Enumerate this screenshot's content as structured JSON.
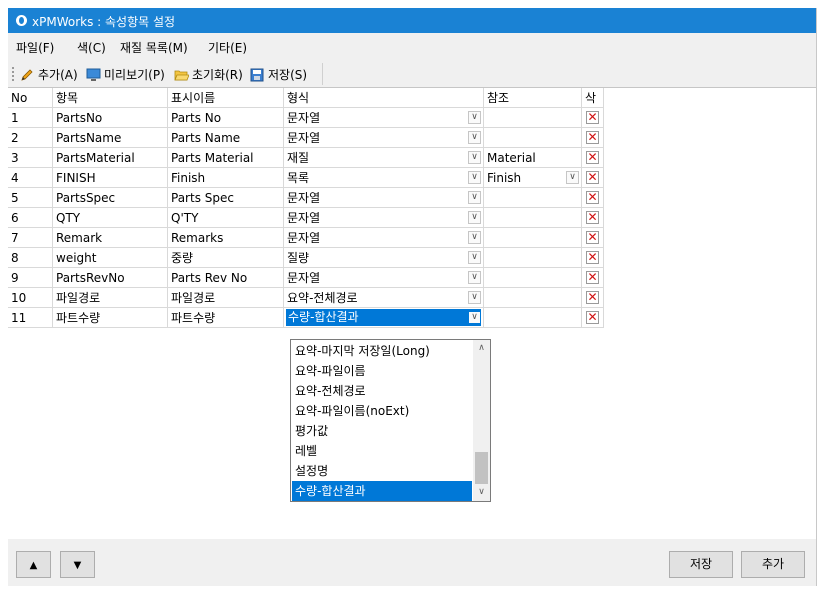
{
  "window": {
    "title": "xPMWorks : 속성항목 설정"
  },
  "menu": [
    {
      "label": "파일(F)"
    },
    {
      "label": "색(C)"
    },
    {
      "label": "재질 목록(M)"
    },
    {
      "label": "기타(E)"
    }
  ],
  "toolbar": {
    "add": "추가(A)",
    "preview": "미리보기(P)",
    "reset": "초기화(R)",
    "save": "저장(S)"
  },
  "columns": [
    "No",
    "항목",
    "표시이름",
    "형식",
    "참조",
    "삭"
  ],
  "rows": [
    {
      "no": "1",
      "item": "PartsNo",
      "display": "Parts No",
      "format": "문자열",
      "ref": ""
    },
    {
      "no": "2",
      "item": "PartsName",
      "display": "Parts Name",
      "format": "문자열",
      "ref": ""
    },
    {
      "no": "3",
      "item": "PartsMaterial",
      "display": "Parts Material",
      "format": "재질",
      "ref": "Material"
    },
    {
      "no": "4",
      "item": "FINISH",
      "display": "Finish",
      "format": "목록",
      "ref": "Finish",
      "ref_combo": true
    },
    {
      "no": "5",
      "item": "PartsSpec",
      "display": "Parts Spec",
      "format": "문자열",
      "ref": ""
    },
    {
      "no": "6",
      "item": "QTY",
      "display": "Q'TY",
      "format": "문자열",
      "ref": ""
    },
    {
      "no": "7",
      "item": "Remark",
      "display": "Remarks",
      "format": "문자열",
      "ref": ""
    },
    {
      "no": "8",
      "item": "weight",
      "display": "중량",
      "format": "질량",
      "ref": ""
    },
    {
      "no": "9",
      "item": "PartsRevNo",
      "display": "Parts Rev No",
      "format": "문자열",
      "ref": ""
    },
    {
      "no": "10",
      "item": "파일경로",
      "display": "파일경로",
      "format": "요약-전체경로",
      "ref": ""
    },
    {
      "no": "11",
      "item": "파트수량",
      "display": "파트수량",
      "format": "수량-합산결과",
      "ref": "",
      "editing": true
    }
  ],
  "dropdown": {
    "options": [
      "요약-마지막 저장일(Long)",
      "요약-파일이름",
      "요약-전체경로",
      "요약-파일이름(noExt)",
      "평가값",
      "레벨",
      "설정명",
      "수량-합산결과"
    ],
    "selected": "수량-합산결과"
  },
  "buttons": {
    "up": "▲",
    "down": "▼",
    "save": "저장",
    "add": "추가"
  },
  "colors": {
    "titlebar": "#1a82d4",
    "selection": "#0078d7",
    "delete": "#d01010"
  }
}
